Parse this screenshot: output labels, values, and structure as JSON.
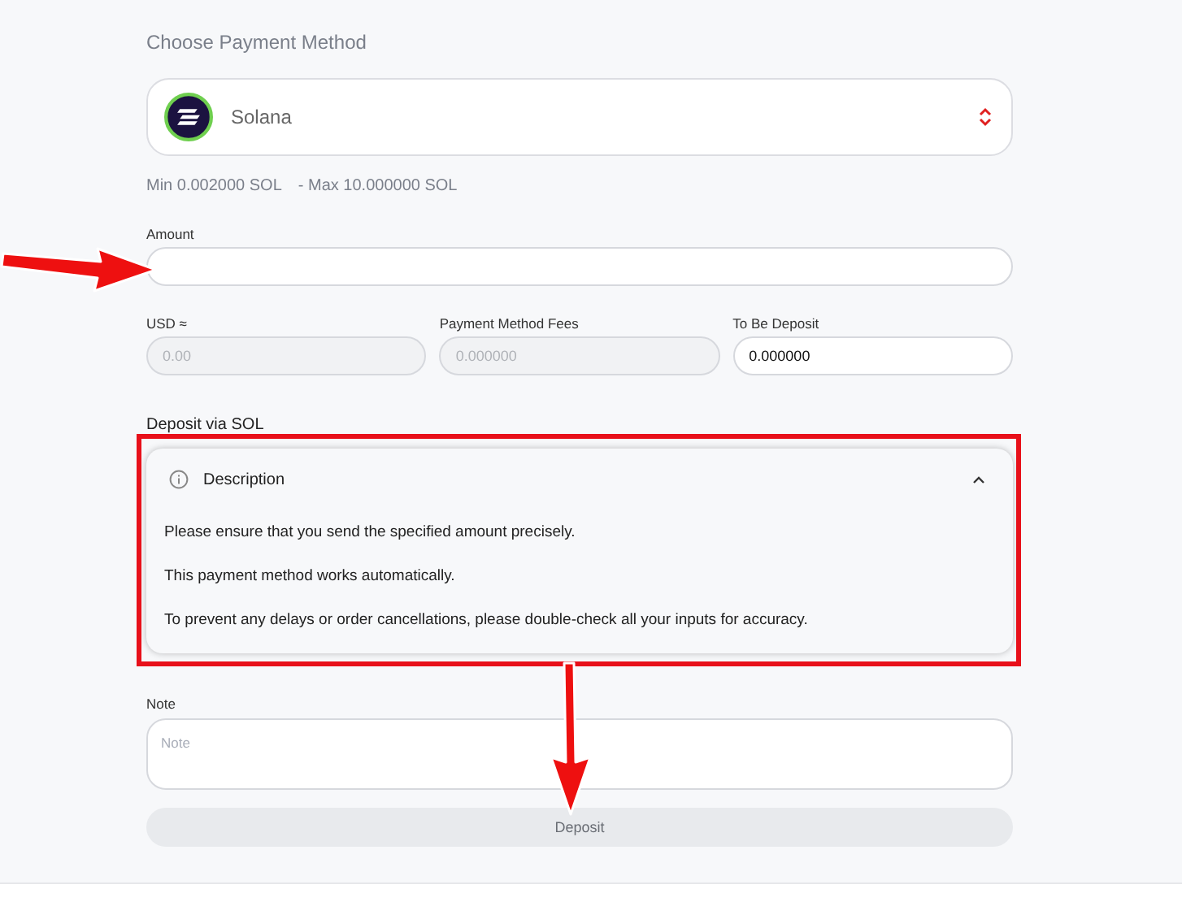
{
  "payment_method": {
    "label": "Choose Payment Method",
    "selected_option": "Solana",
    "limits": {
      "min": "Min 0.002000 SOL",
      "max": "- Max 10.000000 SOL"
    }
  },
  "amount": {
    "label": "Amount"
  },
  "summary_fields": [
    {
      "label": "USD ≈",
      "value": "0.00",
      "disabled": true
    },
    {
      "label": "Payment Method Fees",
      "value": "0.000000",
      "disabled": true
    },
    {
      "label": "To Be Deposit",
      "value": "0.000000",
      "disabled": false
    }
  ],
  "deposit_via": "Deposit via SOL",
  "description": {
    "title": "Description",
    "expanded": true,
    "lines": [
      "Please ensure that you send the specified amount precisely.",
      "This payment method works automatically.",
      "To prevent any delays or order cancellations, please double-check all your inputs for accuracy."
    ]
  },
  "note": {
    "label": "Note",
    "placeholder": "Note"
  },
  "submit": {
    "label": "Deposit",
    "disabled": true
  }
}
